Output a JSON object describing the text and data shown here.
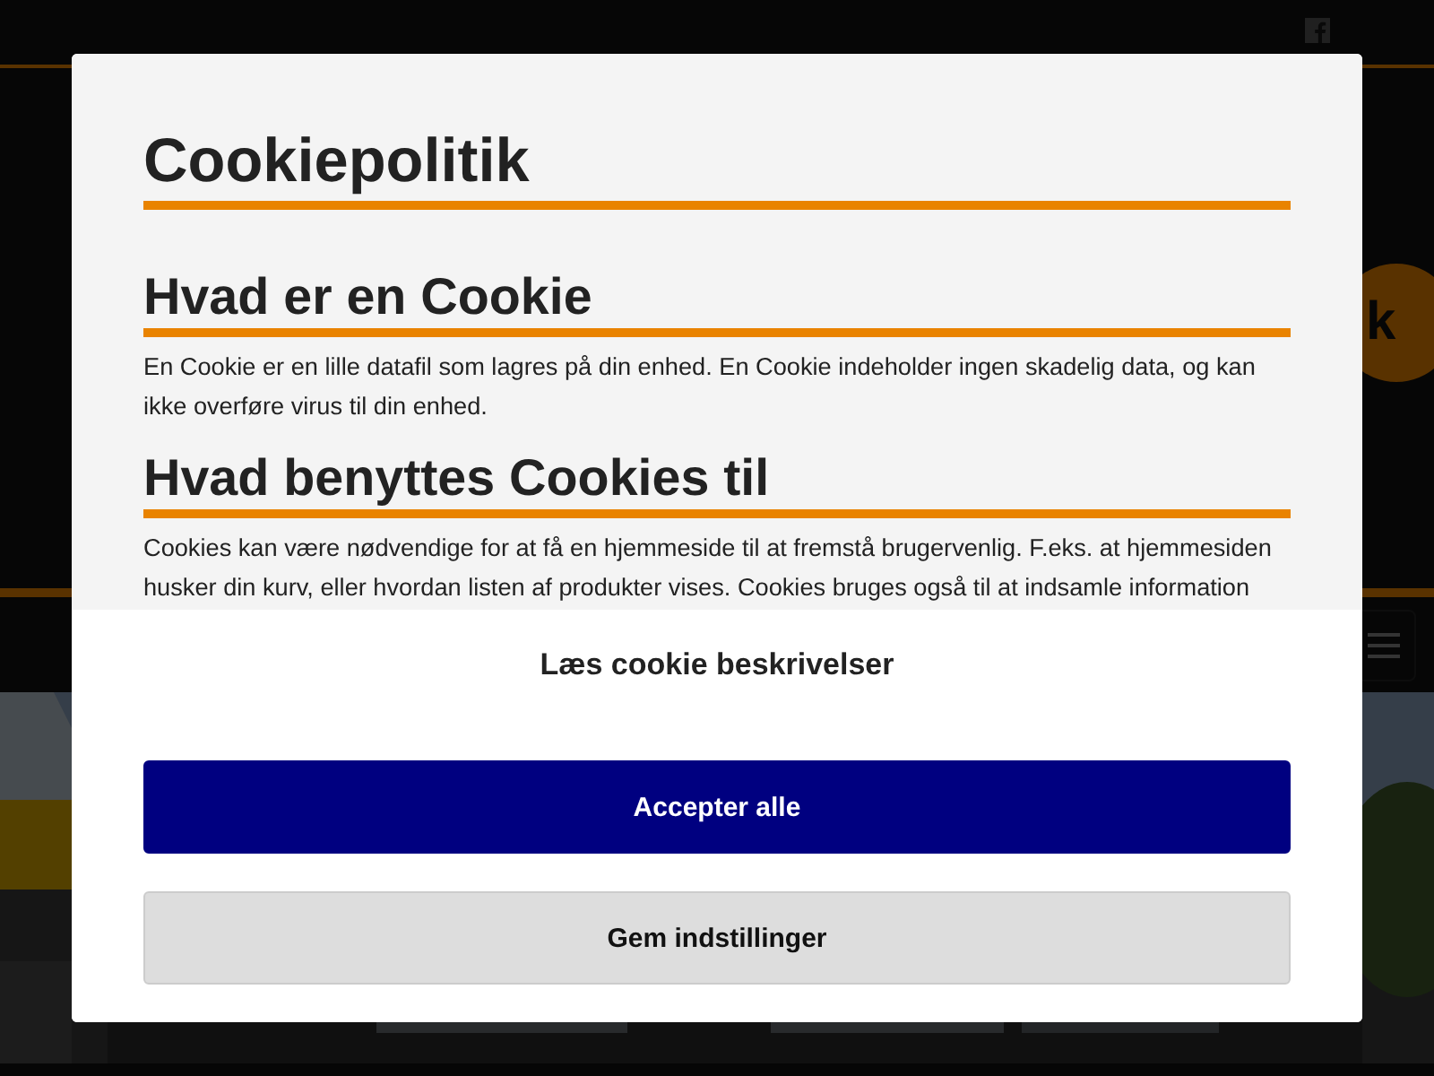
{
  "page": {
    "badge_text": "k"
  },
  "dialog": {
    "title": "Cookiepolitik",
    "sections": [
      {
        "heading": "Hvad er en Cookie",
        "text": "En Cookie er en lille datafil som lagres på din enhed. En Cookie indeholder ingen skadelig data, og kan ikke overføre virus til din enhed."
      },
      {
        "heading": "Hvad benyttes Cookies til",
        "text": "Cookies kan være nødvendige for at få en hjemmeside til at fremstå brugervenlig. F.eks. at hjemmesiden husker din kurv, eller hvordan listen af produkter vises. Cookies bruges også til at indsamle information"
      }
    ],
    "link": "Læs cookie beskrivelser",
    "buttons": [
      {
        "label": "Accepter alle",
        "kind": "primary"
      },
      {
        "label": "Gem indstillinger",
        "kind": "secondary"
      }
    ]
  }
}
